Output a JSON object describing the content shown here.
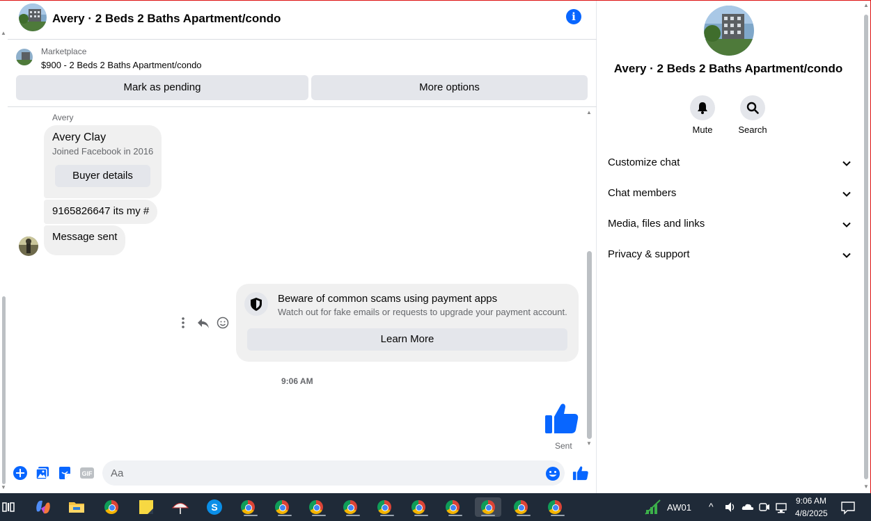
{
  "header": {
    "title": "Avery · 2 Beds 2 Baths Apartment/condo"
  },
  "listing": {
    "source_label": "Marketplace",
    "price_title": "$900 - 2 Beds 2 Baths Apartment/condo",
    "mark_pending_label": "Mark as pending",
    "more_options_label": "More options"
  },
  "messages": {
    "sender_name": "Avery",
    "profile_card": {
      "name": "Avery Clay",
      "joined": "Joined Facebook in 2016",
      "button_label": "Buyer details"
    },
    "msg1": "9165826647 its my #",
    "msg2": "Message sent",
    "scam_notice": {
      "title": "Beware of common scams using payment apps",
      "description": "Watch out for fake emails or requests to upgrade your payment account.",
      "button_label": "Learn More"
    },
    "timestamp": "9:06 AM",
    "sent_label": "Sent"
  },
  "composer": {
    "placeholder": "Aa"
  },
  "info_panel": {
    "title": "Avery · 2 Beds 2 Baths Apartment/condo",
    "actions": [
      "Mute",
      "Search"
    ],
    "sections": [
      "Customize chat",
      "Chat members",
      "Media, files and links",
      "Privacy & support"
    ]
  },
  "taskbar": {
    "tray_label": "AW01",
    "time": "9:06 AM",
    "date": "4/8/2025"
  },
  "colors": {
    "accent": "#0866ff",
    "bubble": "#f0f0f0",
    "button": "#e4e6eb",
    "taskbar": "#1f2a38"
  }
}
